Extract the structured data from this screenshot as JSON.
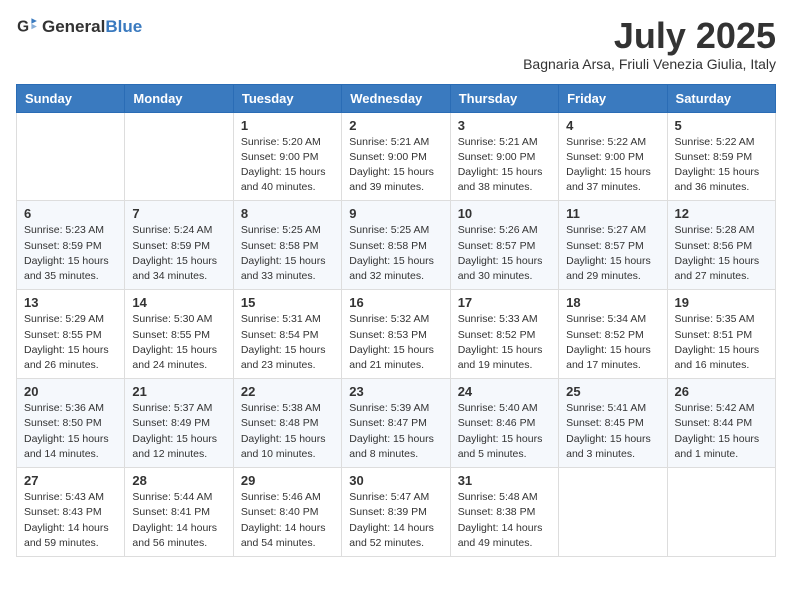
{
  "header": {
    "logo_general": "General",
    "logo_blue": "Blue",
    "month": "July 2025",
    "location": "Bagnaria Arsa, Friuli Venezia Giulia, Italy"
  },
  "columns": [
    "Sunday",
    "Monday",
    "Tuesday",
    "Wednesday",
    "Thursday",
    "Friday",
    "Saturday"
  ],
  "weeks": [
    [
      {
        "day": "",
        "info": ""
      },
      {
        "day": "",
        "info": ""
      },
      {
        "day": "1",
        "info": "Sunrise: 5:20 AM\nSunset: 9:00 PM\nDaylight: 15 hours and 40 minutes."
      },
      {
        "day": "2",
        "info": "Sunrise: 5:21 AM\nSunset: 9:00 PM\nDaylight: 15 hours and 39 minutes."
      },
      {
        "day": "3",
        "info": "Sunrise: 5:21 AM\nSunset: 9:00 PM\nDaylight: 15 hours and 38 minutes."
      },
      {
        "day": "4",
        "info": "Sunrise: 5:22 AM\nSunset: 9:00 PM\nDaylight: 15 hours and 37 minutes."
      },
      {
        "day": "5",
        "info": "Sunrise: 5:22 AM\nSunset: 8:59 PM\nDaylight: 15 hours and 36 minutes."
      }
    ],
    [
      {
        "day": "6",
        "info": "Sunrise: 5:23 AM\nSunset: 8:59 PM\nDaylight: 15 hours and 35 minutes."
      },
      {
        "day": "7",
        "info": "Sunrise: 5:24 AM\nSunset: 8:59 PM\nDaylight: 15 hours and 34 minutes."
      },
      {
        "day": "8",
        "info": "Sunrise: 5:25 AM\nSunset: 8:58 PM\nDaylight: 15 hours and 33 minutes."
      },
      {
        "day": "9",
        "info": "Sunrise: 5:25 AM\nSunset: 8:58 PM\nDaylight: 15 hours and 32 minutes."
      },
      {
        "day": "10",
        "info": "Sunrise: 5:26 AM\nSunset: 8:57 PM\nDaylight: 15 hours and 30 minutes."
      },
      {
        "day": "11",
        "info": "Sunrise: 5:27 AM\nSunset: 8:57 PM\nDaylight: 15 hours and 29 minutes."
      },
      {
        "day": "12",
        "info": "Sunrise: 5:28 AM\nSunset: 8:56 PM\nDaylight: 15 hours and 27 minutes."
      }
    ],
    [
      {
        "day": "13",
        "info": "Sunrise: 5:29 AM\nSunset: 8:55 PM\nDaylight: 15 hours and 26 minutes."
      },
      {
        "day": "14",
        "info": "Sunrise: 5:30 AM\nSunset: 8:55 PM\nDaylight: 15 hours and 24 minutes."
      },
      {
        "day": "15",
        "info": "Sunrise: 5:31 AM\nSunset: 8:54 PM\nDaylight: 15 hours and 23 minutes."
      },
      {
        "day": "16",
        "info": "Sunrise: 5:32 AM\nSunset: 8:53 PM\nDaylight: 15 hours and 21 minutes."
      },
      {
        "day": "17",
        "info": "Sunrise: 5:33 AM\nSunset: 8:52 PM\nDaylight: 15 hours and 19 minutes."
      },
      {
        "day": "18",
        "info": "Sunrise: 5:34 AM\nSunset: 8:52 PM\nDaylight: 15 hours and 17 minutes."
      },
      {
        "day": "19",
        "info": "Sunrise: 5:35 AM\nSunset: 8:51 PM\nDaylight: 15 hours and 16 minutes."
      }
    ],
    [
      {
        "day": "20",
        "info": "Sunrise: 5:36 AM\nSunset: 8:50 PM\nDaylight: 15 hours and 14 minutes."
      },
      {
        "day": "21",
        "info": "Sunrise: 5:37 AM\nSunset: 8:49 PM\nDaylight: 15 hours and 12 minutes."
      },
      {
        "day": "22",
        "info": "Sunrise: 5:38 AM\nSunset: 8:48 PM\nDaylight: 15 hours and 10 minutes."
      },
      {
        "day": "23",
        "info": "Sunrise: 5:39 AM\nSunset: 8:47 PM\nDaylight: 15 hours and 8 minutes."
      },
      {
        "day": "24",
        "info": "Sunrise: 5:40 AM\nSunset: 8:46 PM\nDaylight: 15 hours and 5 minutes."
      },
      {
        "day": "25",
        "info": "Sunrise: 5:41 AM\nSunset: 8:45 PM\nDaylight: 15 hours and 3 minutes."
      },
      {
        "day": "26",
        "info": "Sunrise: 5:42 AM\nSunset: 8:44 PM\nDaylight: 15 hours and 1 minute."
      }
    ],
    [
      {
        "day": "27",
        "info": "Sunrise: 5:43 AM\nSunset: 8:43 PM\nDaylight: 14 hours and 59 minutes."
      },
      {
        "day": "28",
        "info": "Sunrise: 5:44 AM\nSunset: 8:41 PM\nDaylight: 14 hours and 56 minutes."
      },
      {
        "day": "29",
        "info": "Sunrise: 5:46 AM\nSunset: 8:40 PM\nDaylight: 14 hours and 54 minutes."
      },
      {
        "day": "30",
        "info": "Sunrise: 5:47 AM\nSunset: 8:39 PM\nDaylight: 14 hours and 52 minutes."
      },
      {
        "day": "31",
        "info": "Sunrise: 5:48 AM\nSunset: 8:38 PM\nDaylight: 14 hours and 49 minutes."
      },
      {
        "day": "",
        "info": ""
      },
      {
        "day": "",
        "info": ""
      }
    ]
  ]
}
